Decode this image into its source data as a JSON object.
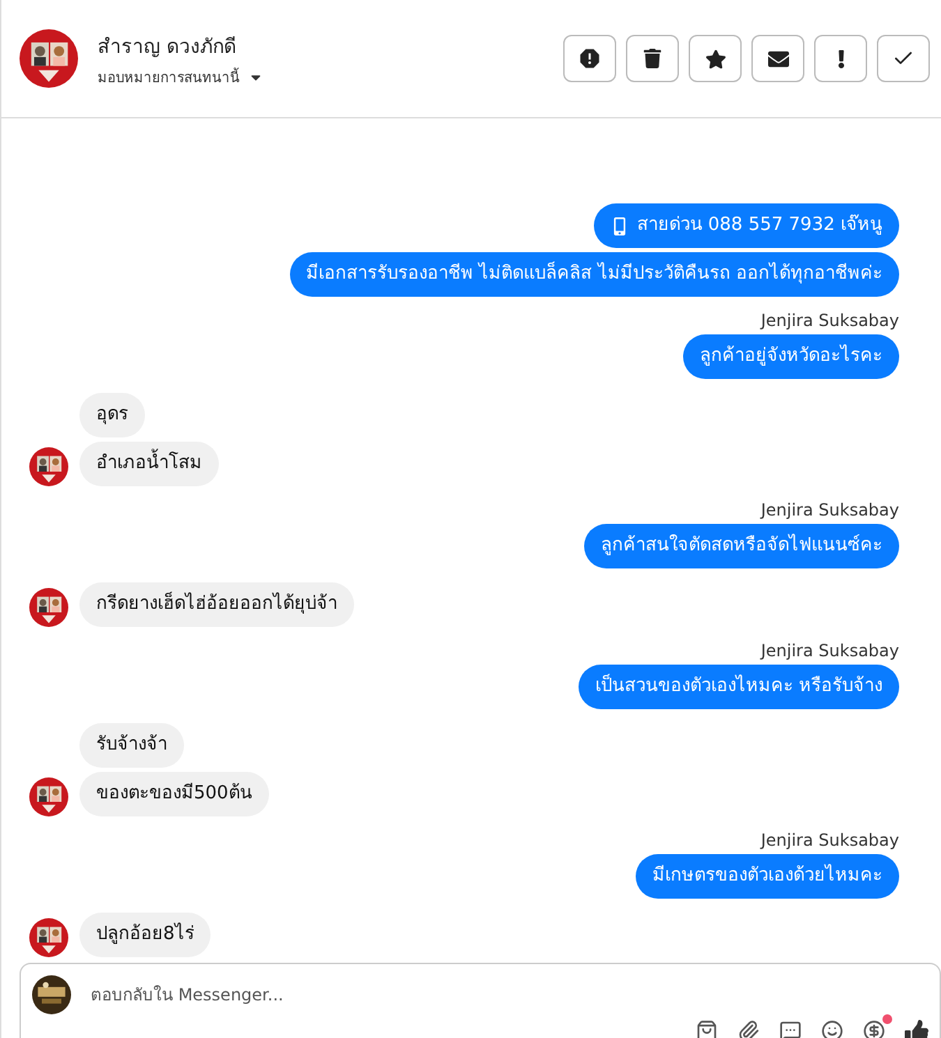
{
  "header": {
    "name": "สำราญ ดวงภักดี",
    "assign": "มอบหมายการสนทนานี้"
  },
  "actions": [
    {
      "kind": "report"
    },
    {
      "kind": "trash"
    },
    {
      "kind": "star"
    },
    {
      "kind": "mail"
    },
    {
      "kind": "alert"
    },
    {
      "kind": "done"
    }
  ],
  "messages": [
    {
      "kind": "outgoing",
      "texts": [
        "สายด่วน 088 557 7932 เจ๊หนู",
        "มีเอกสารรับรองอาชีพ ไม่ติดแบล็คลิส ไม่มีประวัติคืนรถ ออกได้ทุกอาชีพค่ะ"
      ]
    },
    {
      "kind": "outgoing",
      "sender": "Jenjira Suksabay",
      "texts": [
        "ลูกค้าอยู่จังหวัดอะไรคะ"
      ]
    },
    {
      "kind": "incoming",
      "texts": [
        "อุดร",
        "อำเภอน้ำโสม"
      ]
    },
    {
      "kind": "outgoing",
      "sender": "Jenjira Suksabay",
      "texts": [
        "ลูกค้าสนใจตัดสดหรือจัดไฟแนนซ์คะ"
      ]
    },
    {
      "kind": "incoming",
      "texts": [
        "กรีดยางเฮ็ดไฮ่อ้อยออกได้ยุบ่จ้า"
      ]
    },
    {
      "kind": "outgoing",
      "sender": "Jenjira Suksabay",
      "texts": [
        "เป็นสวนของตัวเองไหมคะ หรือรับจ้าง"
      ]
    },
    {
      "kind": "incoming",
      "texts": [
        "รับจ้างจ้า",
        "ของตะของมี500ต้น"
      ]
    },
    {
      "kind": "outgoing",
      "sender": "Jenjira Suksabay",
      "texts": [
        "มีเกษตรของตัวเองด้วยไหมคะ"
      ]
    },
    {
      "kind": "incoming",
      "texts": [
        "ปลูกอ้อย8ไร่"
      ]
    }
  ],
  "composer": {
    "placeholder": "ตอบกลับใน Messenger..."
  }
}
